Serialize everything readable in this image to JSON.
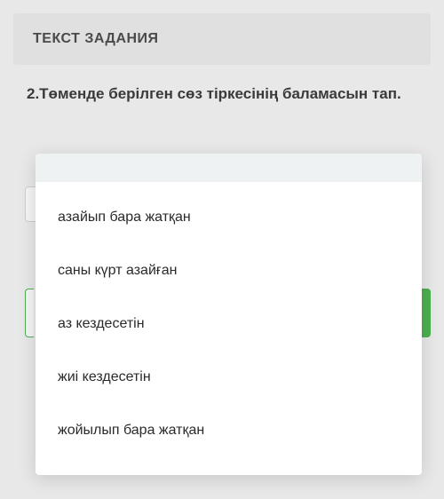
{
  "header": {
    "title": "ТЕКСТ ЗАДАНИЯ"
  },
  "question": {
    "text": "2.Төменде берілген сөз тіркесінің баламасын тап."
  },
  "dropdown": {
    "options": [
      "азайып бара жатқан",
      "саны күрт азайған",
      "аз кездесетін",
      "жиі кездесетін",
      "жойылып бара жатқан"
    ]
  }
}
